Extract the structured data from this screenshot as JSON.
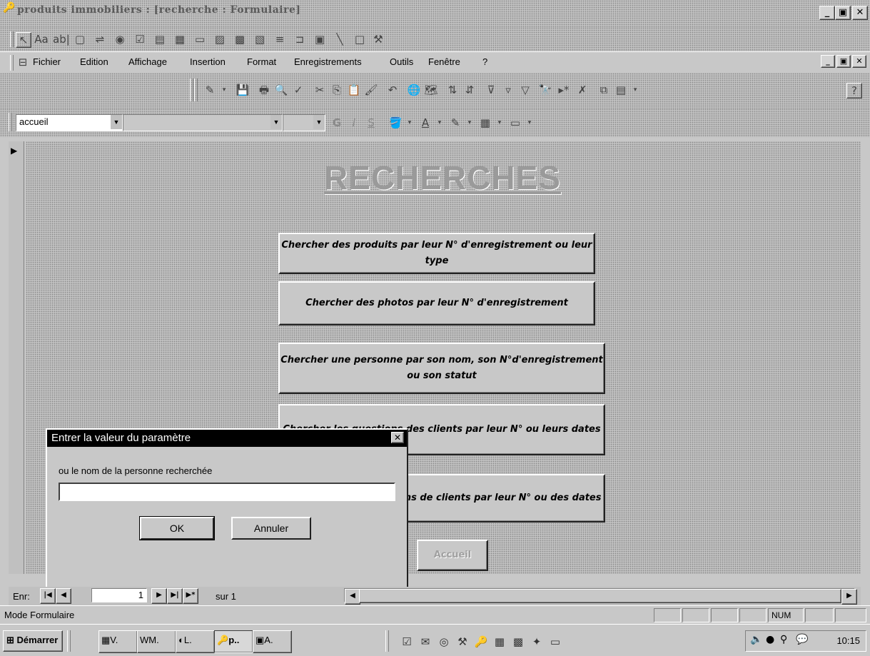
{
  "window": {
    "title": "produits immobiliers : [recherche : Formulaire]"
  },
  "menu": {
    "items": [
      "Fichier",
      "Edition",
      "Affichage",
      "Insertion",
      "Format",
      "Enregistrements",
      "Outils",
      "Fenêtre",
      "?"
    ]
  },
  "format_bar": {
    "object_combo": "accueil",
    "font_combo": "",
    "size_combo": ""
  },
  "form": {
    "heading": "RECHERCHES",
    "buttons": [
      "Chercher des produits par leur N° d'enregistrement ou leur type",
      "Chercher des photos par leur N° d'enregistrement",
      "Chercher une personne par son nom, son N°d'enregistrement ou son statut",
      "Chercher les questions des clients par leur N° ou leurs dates",
      "Chercher les réservations de clients par leur N° ou des dates"
    ],
    "home_button": "Accueil"
  },
  "dialog": {
    "title": "Entrer la valeur du paramètre",
    "close_glyph": "✕",
    "prompt": "ou le nom de la personne recherchée",
    "input_value": "",
    "ok_label": "OK",
    "cancel_label": "Annuler"
  },
  "navigation": {
    "label": "Enr:",
    "current_record": "1",
    "total_text": "sur 1"
  },
  "status": {
    "text": "Mode Formulaire",
    "num_indicator": "NUM"
  },
  "taskbar": {
    "start_label": "Démarrer",
    "tasks": [
      "V.",
      "M.",
      "L.",
      "p..",
      "A."
    ],
    "clock": "10:15"
  }
}
